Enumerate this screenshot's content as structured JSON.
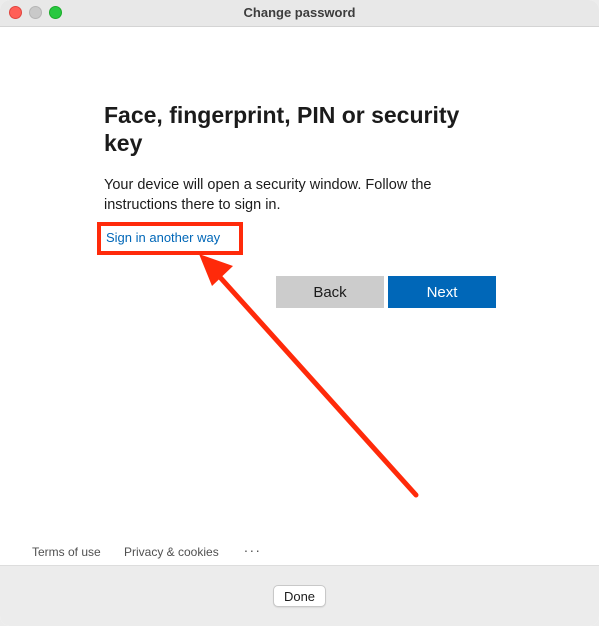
{
  "window": {
    "title": "Change password"
  },
  "main": {
    "heading": "Face, fingerprint, PIN or security key",
    "description": "Your device will open a security window. Follow the instructions there to sign in.",
    "sign_in_link": "Sign in another way",
    "back_label": "Back",
    "next_label": "Next"
  },
  "footer": {
    "terms": "Terms of use",
    "privacy": "Privacy & cookies",
    "more": "..."
  },
  "bottom": {
    "done_label": "Done"
  },
  "colors": {
    "accent": "#0067b8",
    "annotation": "#ff2a0a"
  }
}
